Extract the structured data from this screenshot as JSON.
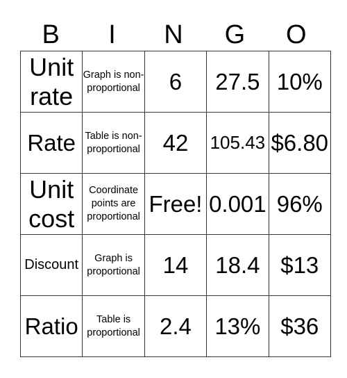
{
  "header": [
    "B",
    "I",
    "N",
    "G",
    "O"
  ],
  "rows": [
    [
      "Unit rate",
      "Graph is non-proportional",
      "6",
      "27.5",
      "10%"
    ],
    [
      "Rate",
      "Table is non-proportional",
      "42",
      "105.43",
      "$6.80"
    ],
    [
      "Unit cost",
      "Coordinate points are proportional",
      "Free!",
      "0.001",
      "96%"
    ],
    [
      "Discount",
      "Graph is proportional",
      "14",
      "18.4",
      "$13"
    ],
    [
      "Ratio",
      "Table is proportional",
      "2.4",
      "13%",
      "$36"
    ]
  ]
}
